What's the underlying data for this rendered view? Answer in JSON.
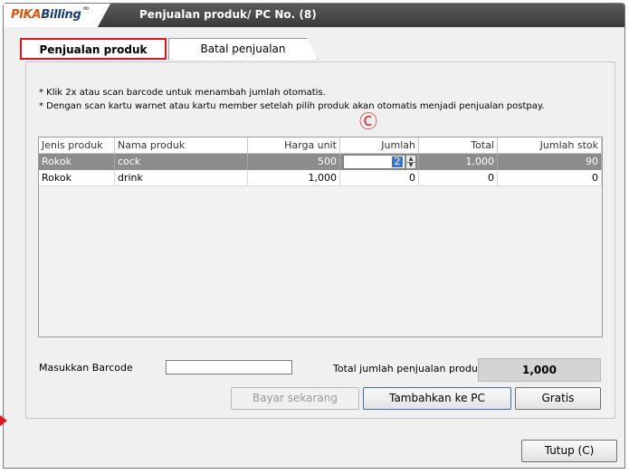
{
  "window": {
    "logo_pika": "PIKA",
    "logo_billing": "Billing",
    "logo_dots": "°°",
    "title": "Penjualan produk/ PC No. (8)"
  },
  "tabs": [
    {
      "label": "Penjualan produk",
      "active": true
    },
    {
      "label": "Batal penjualan",
      "active": false
    }
  ],
  "info_lines": [
    "* Klik 2x atau scan barcode untuk menambah jumlah otomatis.",
    "* Dengan scan kartu warnet atau kartu member setelah pilih produk akan otomatis menjadi penjualan postpay."
  ],
  "marker": "Ⓒ",
  "table": {
    "columns": [
      "Jenis produk",
      "Nama produk",
      "Harga unit",
      "Jumlah",
      "Total",
      "Jumlah stok"
    ],
    "rows": [
      {
        "type": "Rokok",
        "name": "cock",
        "price": "500",
        "qty": "2",
        "total": "1,000",
        "stock": "90",
        "selected": true
      },
      {
        "type": "Rokok",
        "name": "drink",
        "price": "1,000",
        "qty": "0",
        "total": "0",
        "stock": "0",
        "selected": false
      }
    ]
  },
  "barcode": {
    "label": "Masukkan Barcode",
    "value": ""
  },
  "total_sales": {
    "label": "Total jumlah penjualan produk",
    "value": "1,000"
  },
  "buttons": {
    "pay_now": "Bayar sekarang",
    "add_to_pc": "Tambahkan ke PC",
    "free": "Gratis",
    "close": "Tutup (C)"
  },
  "colors": {
    "accent_red": "#e8131d",
    "title_bar": "#3a3a3a",
    "selected_row": "#8c8c8c"
  }
}
